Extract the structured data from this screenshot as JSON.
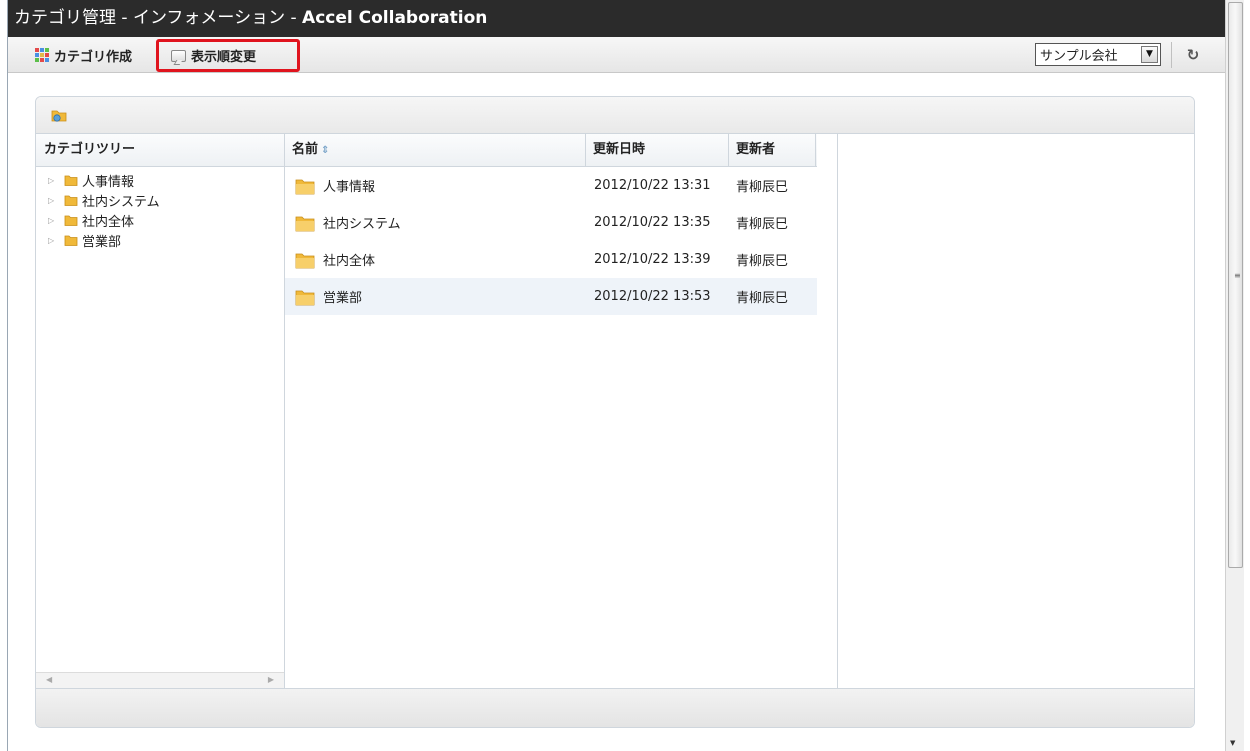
{
  "window": {
    "title_prefix": "カテゴリ管理 - インフォメーション - ",
    "title_app": "Accel Collaboration"
  },
  "toolbar": {
    "create_label": "カテゴリ作成",
    "order_label": "表示順変更",
    "company_value": "サンプル会社",
    "refresh_icon": "refresh-icon"
  },
  "tree": {
    "header": "カテゴリツリー",
    "items": [
      {
        "label": "人事情報"
      },
      {
        "label": "社内システム"
      },
      {
        "label": "社内全体"
      },
      {
        "label": "営業部"
      }
    ]
  },
  "list": {
    "headers": {
      "name": "名前",
      "updated": "更新日時",
      "updater": "更新者"
    },
    "rows": [
      {
        "name": "人事情報",
        "updated": "2012/10/22 13:31",
        "updater": "青柳辰巳"
      },
      {
        "name": "社内システム",
        "updated": "2012/10/22 13:35",
        "updater": "青柳辰巳"
      },
      {
        "name": "社内全体",
        "updated": "2012/10/22 13:39",
        "updater": "青柳辰巳"
      },
      {
        "name": "営業部",
        "updated": "2012/10/22 13:53",
        "updater": "青柳辰巳"
      }
    ]
  },
  "colors": {
    "titlebar": "#2b2b2b",
    "highlight_border": "#e0141e",
    "folder": "#f0b93a",
    "selected_row": "#eef3f9"
  }
}
